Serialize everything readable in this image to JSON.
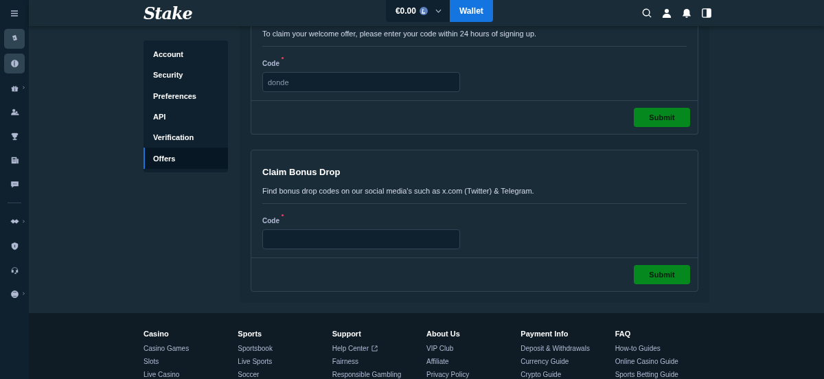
{
  "header": {
    "logo": "Stake",
    "balance": "€0.00",
    "wallet_button": "Wallet"
  },
  "sidebar": {
    "items": [
      {
        "kind": "tile",
        "has_submenu": false
      },
      {
        "kind": "tile",
        "has_submenu": false
      },
      {
        "kind": "plain",
        "has_submenu": true
      },
      {
        "kind": "plain",
        "has_submenu": false
      },
      {
        "kind": "plain",
        "has_submenu": false
      },
      {
        "kind": "plain",
        "has_submenu": false
      },
      {
        "kind": "plain",
        "has_submenu": false
      },
      {
        "kind": "divider"
      },
      {
        "kind": "plain",
        "has_submenu": true
      },
      {
        "kind": "plain",
        "has_submenu": false
      },
      {
        "kind": "plain",
        "has_submenu": false
      },
      {
        "kind": "plain",
        "has_submenu": true
      }
    ]
  },
  "settings_nav": [
    {
      "label": "Account",
      "selected": false
    },
    {
      "label": "Security",
      "selected": false
    },
    {
      "label": "Preferences",
      "selected": false
    },
    {
      "label": "API",
      "selected": false
    },
    {
      "label": "Verification",
      "selected": false
    },
    {
      "label": "Offers",
      "selected": true
    }
  ],
  "cards": [
    {
      "description": "To claim your welcome offer, please enter your code within 24 hours of signing up.",
      "field_label": "Code",
      "required": true,
      "value": "donde",
      "submit": "Submit"
    },
    {
      "title": "Claim Bonus Drop",
      "description": "Find bonus drop codes on our social media's such as x.com (Twitter) & Telegram.",
      "field_label": "Code",
      "required": true,
      "submit": "Submit"
    }
  ],
  "footer": {
    "columns": [
      {
        "heading": "Casino",
        "links": [
          {
            "label": "Casino Games",
            "external": false
          },
          {
            "label": "Slots",
            "external": false
          },
          {
            "label": "Live Casino",
            "external": false
          }
        ]
      },
      {
        "heading": "Sports",
        "links": [
          {
            "label": "Sportsbook",
            "external": false
          },
          {
            "label": "Live Sports",
            "external": false
          },
          {
            "label": "Soccer",
            "external": false
          }
        ]
      },
      {
        "heading": "Support",
        "links": [
          {
            "label": "Help Center",
            "external": true
          },
          {
            "label": "Fairness",
            "external": false
          },
          {
            "label": "Responsible Gambling",
            "external": false
          }
        ]
      },
      {
        "heading": "About Us",
        "links": [
          {
            "label": "VIP Club",
            "external": false
          },
          {
            "label": "Affiliate",
            "external": false
          },
          {
            "label": "Privacy Policy",
            "external": false
          }
        ]
      },
      {
        "heading": "Payment Info",
        "links": [
          {
            "label": "Deposit & Withdrawals",
            "external": false
          },
          {
            "label": "Currency Guide",
            "external": false
          },
          {
            "label": "Crypto Guide",
            "external": false
          }
        ]
      },
      {
        "heading": "FAQ",
        "links": [
          {
            "label": "How-to Guides",
            "external": false
          },
          {
            "label": "Online Casino Guide",
            "external": false
          },
          {
            "label": "Sports Betting Guide",
            "external": false
          }
        ]
      }
    ]
  }
}
